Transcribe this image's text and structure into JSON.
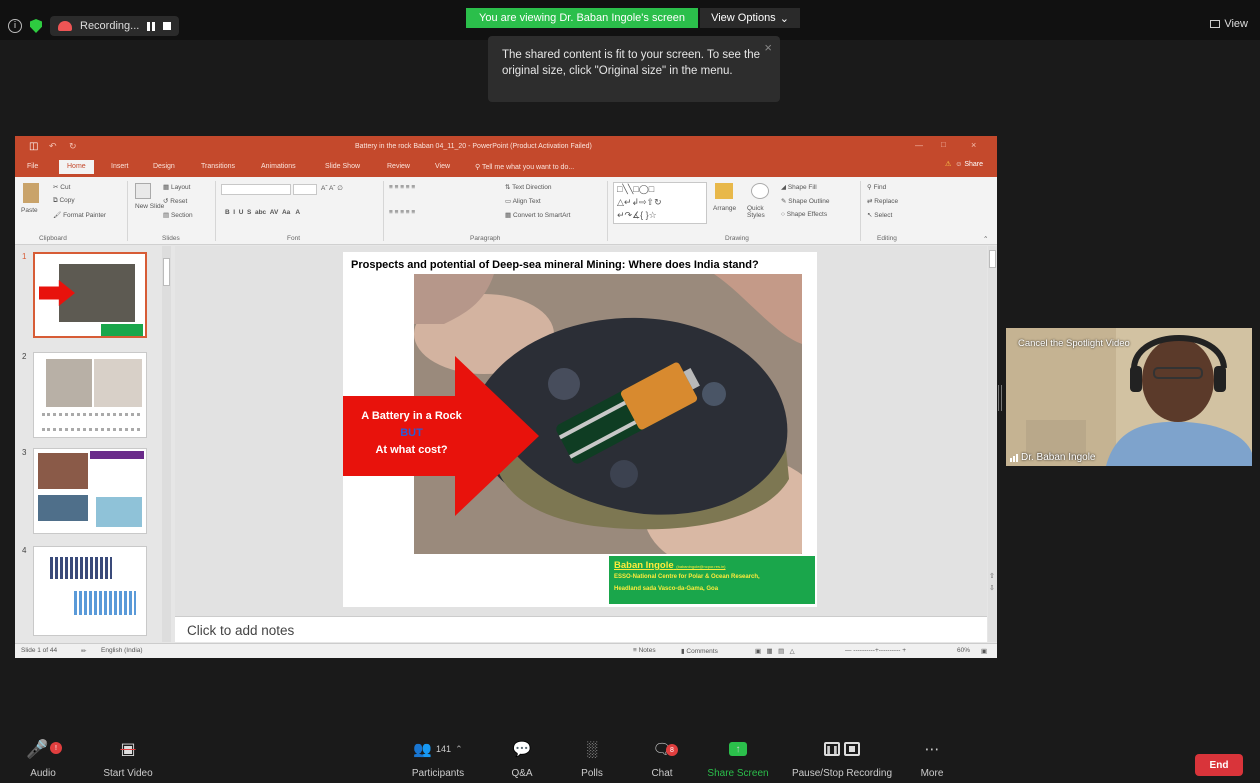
{
  "topbar": {
    "recording_label": "Recording...",
    "viewing_banner": "You are viewing Dr. Baban Ingole's screen",
    "view_options": "View Options",
    "view_button": "View"
  },
  "tooltip": {
    "text": "The shared content is fit to your screen. To see the original size, click \"Original size\" in the menu."
  },
  "ppt": {
    "title": "Battery in the rock  Baban 04_11_20 - PowerPoint (Product Activation Failed)",
    "tabs": [
      "File",
      "Home",
      "Insert",
      "Design",
      "Transitions",
      "Animations",
      "Slide Show",
      "Review",
      "View"
    ],
    "tell_me": "Tell me what you want to do...",
    "share": "Share",
    "ribbon": {
      "clipboard": {
        "paste": "Paste",
        "cut": "Cut",
        "copy": "Copy",
        "format_painter": "Format Painter",
        "group": "Clipboard"
      },
      "slides": {
        "new_slide": "New Slide",
        "layout": "Layout",
        "reset": "Reset",
        "section": "Section",
        "group": "Slides"
      },
      "font_group": "Font",
      "paragraph": {
        "text_direction": "Text Direction",
        "align_text": "Align Text",
        "smartart": "Convert to SmartArt",
        "group": "Paragraph"
      },
      "drawing": {
        "arrange": "Arrange",
        "quick_styles": "Quick Styles",
        "shape_fill": "Shape Fill",
        "shape_outline": "Shape Outline",
        "shape_effects": "Shape Effects",
        "group": "Drawing"
      },
      "editing": {
        "find": "Find",
        "replace": "Replace",
        "select": "Select",
        "group": "Editing"
      }
    },
    "thumb_numbers": [
      "1",
      "2",
      "3",
      "4"
    ],
    "slide": {
      "title": "Prospects and potential of Deep-sea mineral Mining: Where does India stand?",
      "arrow_line1": "A Battery in a Rock",
      "arrow_line2": "BUT",
      "arrow_line3": "At what cost?",
      "author": "Baban Ingole",
      "author_email": "(babaningole@ncpor.res.in)",
      "affil1": "ESSO-National Centre for Polar & Ocean Research,",
      "affil2": "Headland sada Vasco-da-Gama, Goa"
    },
    "notes_placeholder": "Click to add notes",
    "status": {
      "slide": "Slide 1 of 44",
      "language": "English (India)",
      "notes": "Notes",
      "comments": "Comments",
      "zoom": "60%"
    }
  },
  "video": {
    "cancel_spotlight": "Cancel the Spotlight Video",
    "participant_name": "Dr. Baban Ingole"
  },
  "toolbar": {
    "audio": "Audio",
    "start_video": "Start Video",
    "participants": "Participants",
    "participant_count": "141",
    "qa": "Q&A",
    "polls": "Polls",
    "chat": "Chat",
    "chat_badge": "8",
    "share_screen": "Share Screen",
    "pause_stop": "Pause/Stop Recording",
    "more": "More",
    "end": "End"
  },
  "colors": {
    "ppt_accent": "#c4492c",
    "zoom_green": "#2bbf4b",
    "end_red": "#d9343a",
    "slide_green": "#1aa64b",
    "arrow_red": "#e8120c"
  }
}
